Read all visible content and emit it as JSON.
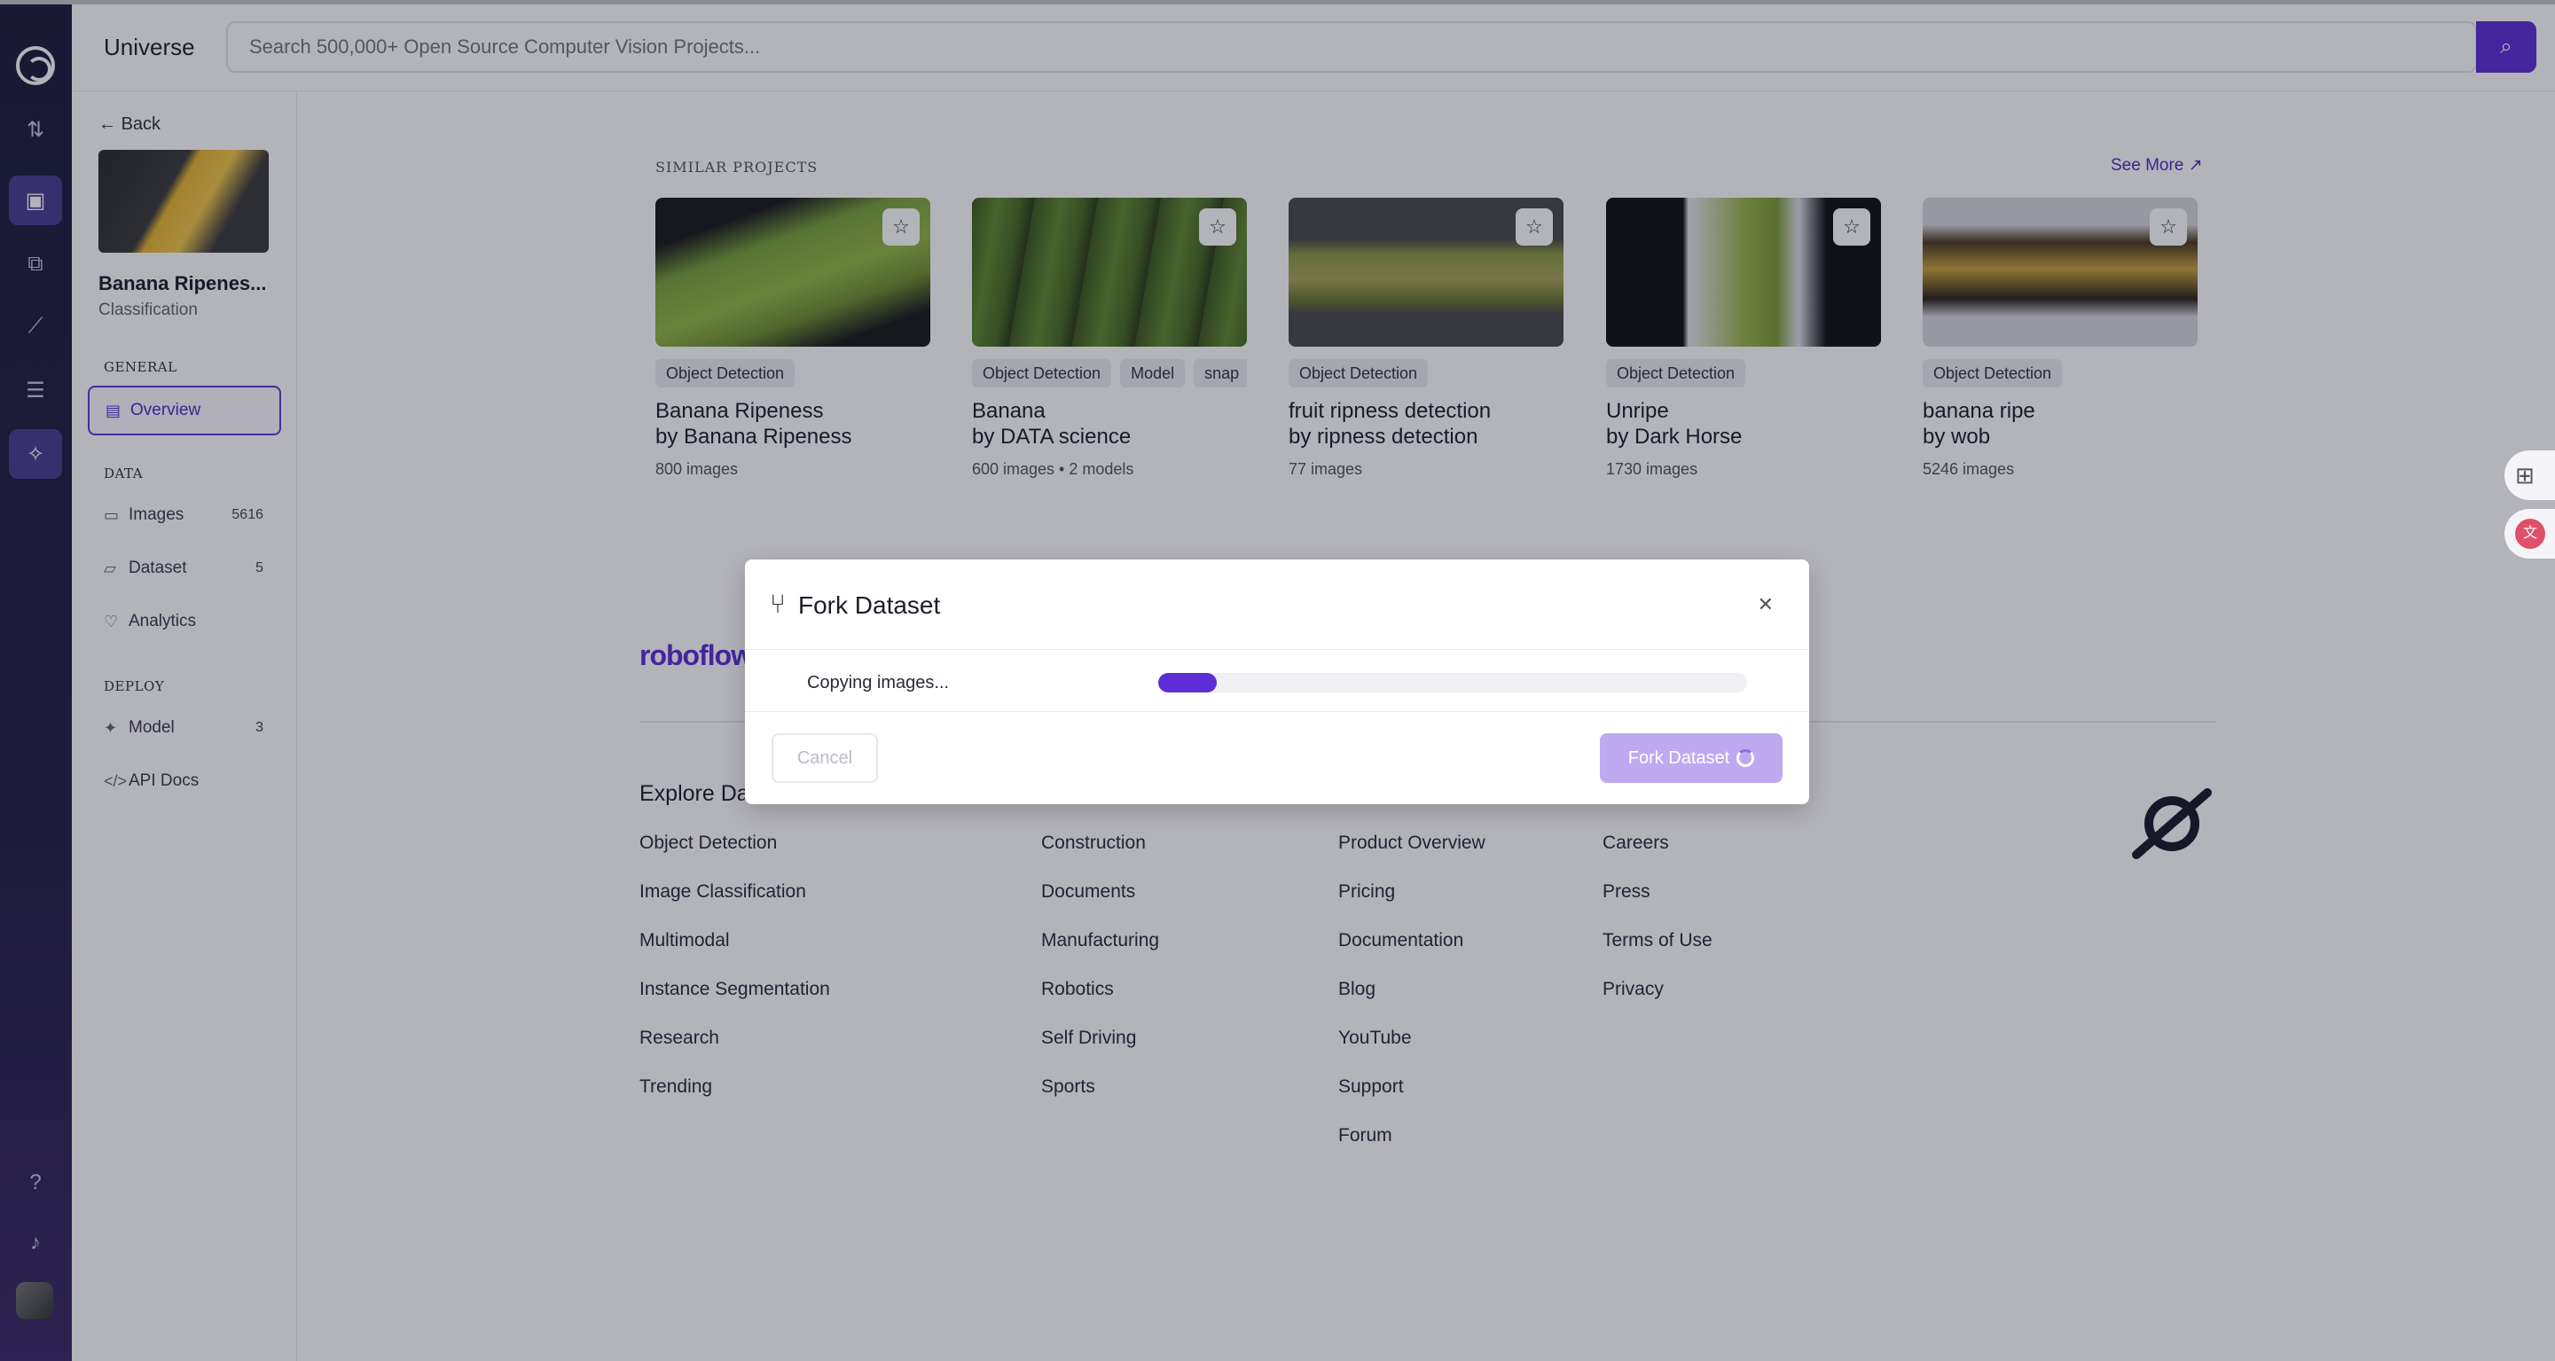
{
  "topbar": {
    "brand": "Universe",
    "search_placeholder": "Search 500,000+ Open Source Computer Vision Projects..."
  },
  "sidebar": {
    "back_label": "Back",
    "project_name": "Banana Ripenes...",
    "project_type": "Classification",
    "sections": {
      "general": "GENERAL",
      "data": "DATA",
      "deploy": "DEPLOY"
    },
    "items": [
      {
        "label": "Overview",
        "icon": "overview-icon",
        "count": ""
      },
      {
        "label": "Images",
        "icon": "images-icon",
        "count": "5616"
      },
      {
        "label": "Dataset",
        "icon": "dataset-icon",
        "count": "5"
      },
      {
        "label": "Analytics",
        "icon": "analytics-icon",
        "count": ""
      },
      {
        "label": "Model",
        "icon": "model-icon",
        "count": "3"
      },
      {
        "label": "API Docs",
        "icon": "code-icon",
        "count": ""
      }
    ]
  },
  "similar": {
    "title": "SIMILAR PROJECTS",
    "see_more": "See More",
    "cards": [
      {
        "tags": [
          "Object Detection"
        ],
        "title": "Banana Ripeness",
        "author": "by Banana Ripeness",
        "meta": "800 images"
      },
      {
        "tags": [
          "Object Detection",
          "Model",
          "snap"
        ],
        "title": "Banana",
        "author": "by DATA science",
        "meta": "600 images  •  2 models"
      },
      {
        "tags": [
          "Object Detection"
        ],
        "title": "fruit ripness detection",
        "author": "by ripness detection",
        "meta": "77 images"
      },
      {
        "tags": [
          "Object Detection"
        ],
        "title": "Unripe",
        "author": "by Dark Horse",
        "meta": "1730 images"
      },
      {
        "tags": [
          "Object Detection"
        ],
        "title": "banana ripe",
        "author": "by wob",
        "meta": "5246 images"
      }
    ]
  },
  "footer": {
    "logo": "roboflow",
    "explore": "Explore Da",
    "col1": [
      "Object Detection",
      "Image Classification",
      "Multimodal",
      "Instance Segmentation",
      "Research",
      "Trending"
    ],
    "col2": [
      "Construction",
      "Documents",
      "Manufacturing",
      "Robotics",
      "Self Driving",
      "Sports"
    ],
    "col3": [
      "Product Overview",
      "Pricing",
      "Documentation",
      "Blog",
      "YouTube",
      "Support",
      "Forum"
    ],
    "col4": [
      "Careers",
      "Press",
      "Terms of Use",
      "Privacy"
    ]
  },
  "modal": {
    "title": "Fork Dataset",
    "status": "Copying images...",
    "progress": 0.1,
    "cancel": "Cancel",
    "fork": "Fork Dataset"
  },
  "colors": {
    "accent": "#5b2ed6",
    "rail": "#1c1d3a"
  }
}
